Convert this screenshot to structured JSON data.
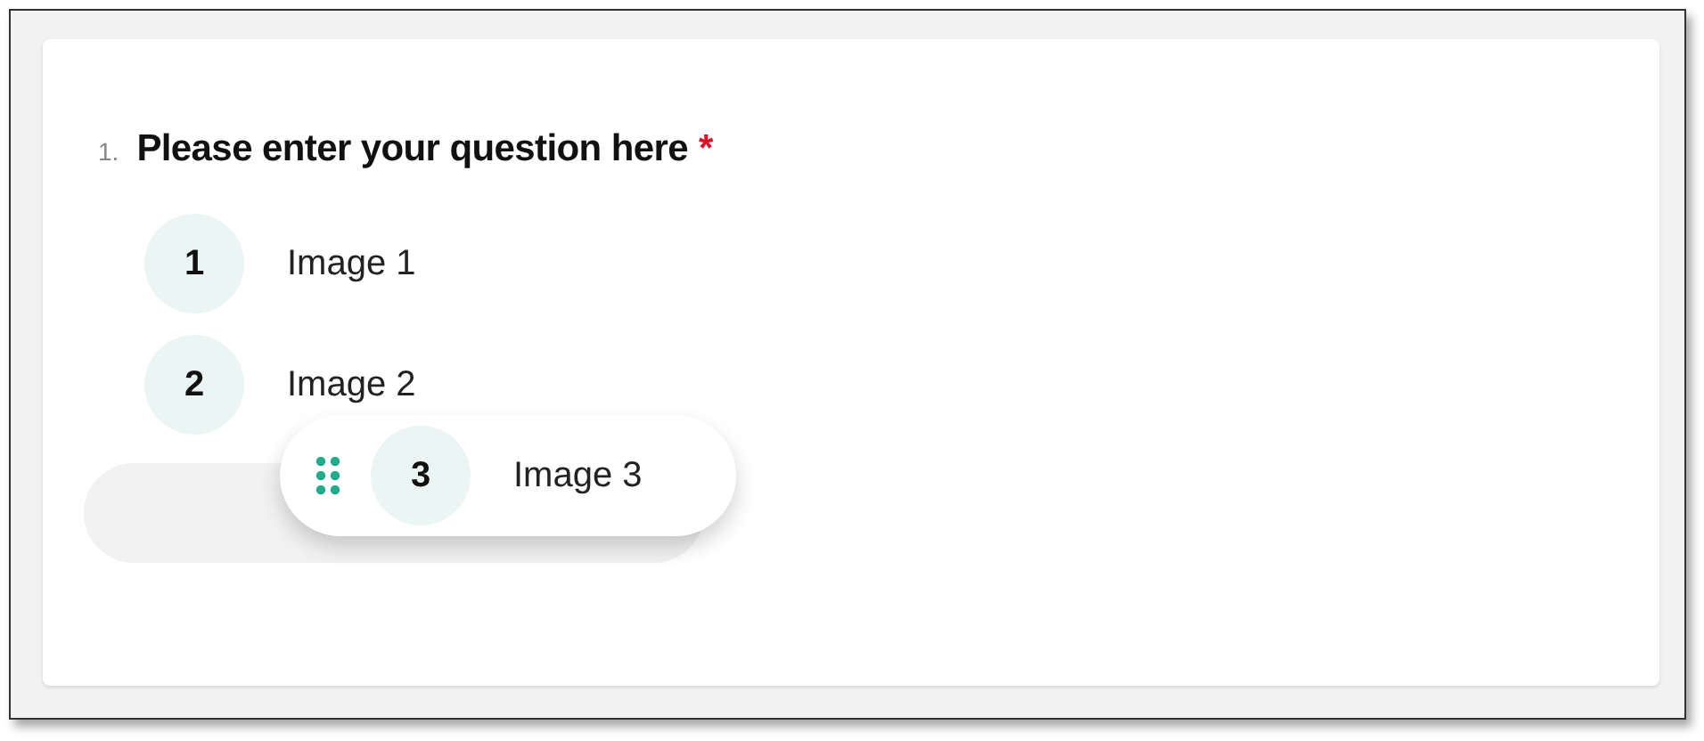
{
  "question": {
    "number": "1.",
    "text": "Please enter your question here",
    "required": true,
    "required_mark": "*"
  },
  "options": [
    {
      "number": "1",
      "label": "Image 1",
      "kind": "static"
    },
    {
      "number": "2",
      "label": "Image 2",
      "kind": "static"
    },
    {
      "number": "3",
      "label": "Image 3",
      "kind": "dragging"
    }
  ]
}
